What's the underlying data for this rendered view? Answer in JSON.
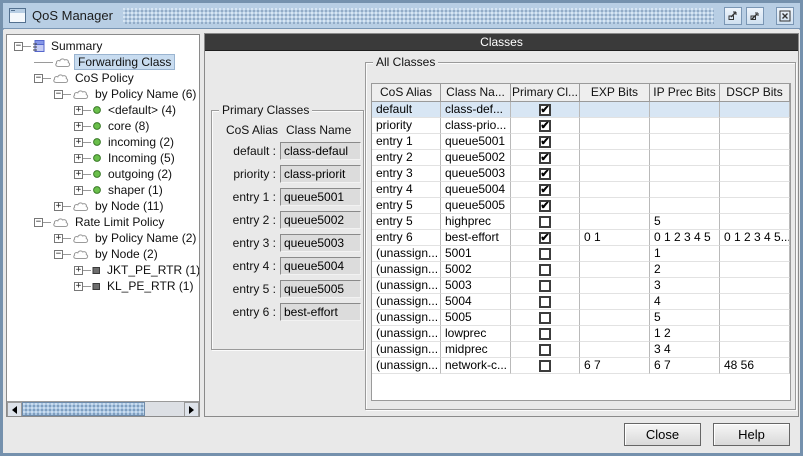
{
  "window": {
    "title": "QoS Manager"
  },
  "panel": {
    "header": "Classes"
  },
  "tree": {
    "items": [
      {
        "label": "Summary",
        "level": 0,
        "handle": "minus",
        "icon": "summary-icon",
        "selected": false
      },
      {
        "label": "Forwarding Class",
        "level": 1,
        "handle": "none",
        "icon": "cloud-icon",
        "selected": true
      },
      {
        "label": "CoS Policy",
        "level": 1,
        "handle": "minus",
        "icon": "cloud-icon",
        "selected": false
      },
      {
        "label": "by Policy Name (6)",
        "level": 2,
        "handle": "minus",
        "icon": "cloud-icon",
        "selected": false
      },
      {
        "label": "<default> (4)",
        "level": 3,
        "handle": "plus",
        "icon": "green-dot-icon",
        "selected": false
      },
      {
        "label": "core (8)",
        "level": 3,
        "handle": "plus",
        "icon": "green-dot-icon",
        "selected": false
      },
      {
        "label": "incoming (2)",
        "level": 3,
        "handle": "plus",
        "icon": "green-dot-icon",
        "selected": false
      },
      {
        "label": "Incoming (5)",
        "level": 3,
        "handle": "plus",
        "icon": "green-dot-icon",
        "selected": false
      },
      {
        "label": "outgoing (2)",
        "level": 3,
        "handle": "plus",
        "icon": "green-dot-icon",
        "selected": false
      },
      {
        "label": "shaper (1)",
        "level": 3,
        "handle": "plus",
        "icon": "green-dot-icon",
        "selected": false
      },
      {
        "label": "by Node (11)",
        "level": 2,
        "handle": "plus",
        "icon": "cloud-icon",
        "selected": false
      },
      {
        "label": "Rate Limit Policy",
        "level": 1,
        "handle": "minus",
        "icon": "cloud-icon",
        "selected": false
      },
      {
        "label": "by Policy Name (2)",
        "level": 2,
        "handle": "plus",
        "icon": "cloud-icon",
        "selected": false
      },
      {
        "label": "by Node (2)",
        "level": 2,
        "handle": "minus",
        "icon": "cloud-icon",
        "selected": false
      },
      {
        "label": "JKT_PE_RTR (1)",
        "level": 3,
        "handle": "plus",
        "icon": "node-icon",
        "selected": false
      },
      {
        "label": "KL_PE_RTR (1)",
        "level": 3,
        "handle": "plus",
        "icon": "node-icon",
        "selected": false
      }
    ]
  },
  "primary_classes": {
    "title": "Primary Classes",
    "col_alias": "CoS Alias",
    "col_name": "Class Name",
    "rows": [
      {
        "label": "default :",
        "value": "class-defaul"
      },
      {
        "label": "priority :",
        "value": "class-priorit"
      },
      {
        "label": "entry 1 :",
        "value": "queue5001"
      },
      {
        "label": "entry 2 :",
        "value": "queue5002"
      },
      {
        "label": "entry 3 :",
        "value": "queue5003"
      },
      {
        "label": "entry 4 :",
        "value": "queue5004"
      },
      {
        "label": "entry 5 :",
        "value": "queue5005"
      },
      {
        "label": "entry 6 :",
        "value": "best-effort"
      }
    ]
  },
  "all_classes": {
    "title": "All Classes",
    "columns": [
      "CoS Alias",
      "Class Na...",
      "Primary Cl...",
      "EXP Bits",
      "IP Prec Bits",
      "DSCP Bits"
    ],
    "rows": [
      {
        "cos_alias": "default",
        "class_name": "class-def...",
        "primary": true,
        "exp_bits": "",
        "ip_prec_bits": "",
        "dscp_bits": "",
        "selected": true
      },
      {
        "cos_alias": "priority",
        "class_name": "class-prio...",
        "primary": true,
        "exp_bits": "",
        "ip_prec_bits": "",
        "dscp_bits": "",
        "selected": false
      },
      {
        "cos_alias": "entry 1",
        "class_name": "queue5001",
        "primary": true,
        "exp_bits": "",
        "ip_prec_bits": "",
        "dscp_bits": "",
        "selected": false
      },
      {
        "cos_alias": "entry 2",
        "class_name": "queue5002",
        "primary": true,
        "exp_bits": "",
        "ip_prec_bits": "",
        "dscp_bits": "",
        "selected": false
      },
      {
        "cos_alias": "entry 3",
        "class_name": "queue5003",
        "primary": true,
        "exp_bits": "",
        "ip_prec_bits": "",
        "dscp_bits": "",
        "selected": false
      },
      {
        "cos_alias": "entry 4",
        "class_name": "queue5004",
        "primary": true,
        "exp_bits": "",
        "ip_prec_bits": "",
        "dscp_bits": "",
        "selected": false
      },
      {
        "cos_alias": "entry 5",
        "class_name": "queue5005",
        "primary": true,
        "exp_bits": "",
        "ip_prec_bits": "",
        "dscp_bits": "",
        "selected": false
      },
      {
        "cos_alias": "entry 5",
        "class_name": "highprec",
        "primary": false,
        "exp_bits": "",
        "ip_prec_bits": "5",
        "dscp_bits": "",
        "selected": false
      },
      {
        "cos_alias": "entry 6",
        "class_name": "best-effort",
        "primary": true,
        "exp_bits": "0 1",
        "ip_prec_bits": "0 1 2 3 4 5",
        "dscp_bits": "0 1 2 3 4 5...",
        "selected": false
      },
      {
        "cos_alias": "(unassign...",
        "class_name": "5001",
        "primary": false,
        "exp_bits": "",
        "ip_prec_bits": "1",
        "dscp_bits": "",
        "selected": false
      },
      {
        "cos_alias": "(unassign...",
        "class_name": "5002",
        "primary": false,
        "exp_bits": "",
        "ip_prec_bits": "2",
        "dscp_bits": "",
        "selected": false
      },
      {
        "cos_alias": "(unassign...",
        "class_name": "5003",
        "primary": false,
        "exp_bits": "",
        "ip_prec_bits": "3",
        "dscp_bits": "",
        "selected": false
      },
      {
        "cos_alias": "(unassign...",
        "class_name": "5004",
        "primary": false,
        "exp_bits": "",
        "ip_prec_bits": "4",
        "dscp_bits": "",
        "selected": false
      },
      {
        "cos_alias": "(unassign...",
        "class_name": "5005",
        "primary": false,
        "exp_bits": "",
        "ip_prec_bits": "5",
        "dscp_bits": "",
        "selected": false
      },
      {
        "cos_alias": "(unassign...",
        "class_name": "lowprec",
        "primary": false,
        "exp_bits": "",
        "ip_prec_bits": "1 2",
        "dscp_bits": "",
        "selected": false
      },
      {
        "cos_alias": "(unassign...",
        "class_name": "midprec",
        "primary": false,
        "exp_bits": "",
        "ip_prec_bits": "3 4",
        "dscp_bits": "",
        "selected": false
      },
      {
        "cos_alias": "(unassign...",
        "class_name": "network-c...",
        "primary": false,
        "exp_bits": "6 7",
        "ip_prec_bits": "6 7",
        "dscp_bits": "48 56",
        "selected": false
      }
    ]
  },
  "buttons": {
    "close": "Close",
    "help": "Help"
  },
  "colors": {
    "titlebar": "#b8cee4",
    "frame": "#7591ad",
    "panel_header_bg": "#3a3a3a",
    "panel_header_text": "#ffffff",
    "row_selection_bg": "#d8e6f4",
    "tree_selection_bg": "#c8dcf0",
    "scroll_thumb": "#a9c6e2",
    "green_dot": "#6abf4b",
    "background": "#e9e9e9"
  }
}
